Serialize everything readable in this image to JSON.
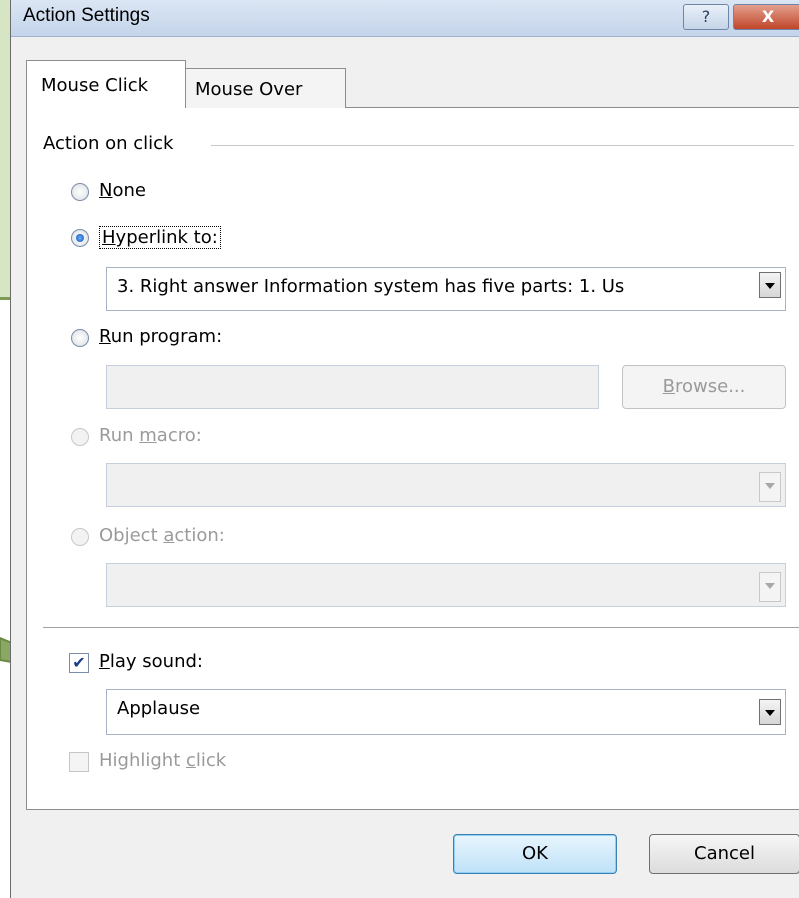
{
  "window": {
    "title": "Action Settings",
    "help_label": "?",
    "close_label": "X"
  },
  "tabs": [
    {
      "label": "Mouse Click",
      "selected": true
    },
    {
      "label": "Mouse Over",
      "selected": false
    }
  ],
  "action_group": {
    "label": "Action on click",
    "options": {
      "none": {
        "mnemonic": "N",
        "rest": "one",
        "selected": false,
        "enabled": true
      },
      "hyperlink": {
        "mnemonic": "H",
        "rest": "yperlink to:",
        "selected": true,
        "enabled": true
      },
      "run_program": {
        "mnemonic": "R",
        "rest": "un program:",
        "selected": false,
        "enabled": true
      },
      "run_macro": {
        "pre": "Run ",
        "mnemonic": "m",
        "rest": "acro:",
        "selected": false,
        "enabled": false
      },
      "object_action": {
        "pre": "Object ",
        "mnemonic": "a",
        "rest": "ction:",
        "selected": false,
        "enabled": false
      }
    },
    "hyperlink_value": "3. Right answer  Information system has five parts: 1. Us",
    "run_program_value": "",
    "browse_label": {
      "mnemonic": "B",
      "rest": "rowse..."
    },
    "run_macro_value": "",
    "object_action_value": ""
  },
  "sound": {
    "play_sound": {
      "mnemonic": "P",
      "rest": "lay sound:",
      "checked": true
    },
    "value": "Applause",
    "highlight_click": {
      "pre": "Highlight ",
      "mnemonic": "c",
      "rest": "lick",
      "checked": false,
      "enabled": false
    }
  },
  "footer": {
    "ok_label": "OK",
    "cancel_label": "Cancel"
  },
  "colors": {
    "callout_fill": "#d6e5c4",
    "callout_border": "#7d9b57",
    "ok_accent": "#3c7fb1"
  }
}
